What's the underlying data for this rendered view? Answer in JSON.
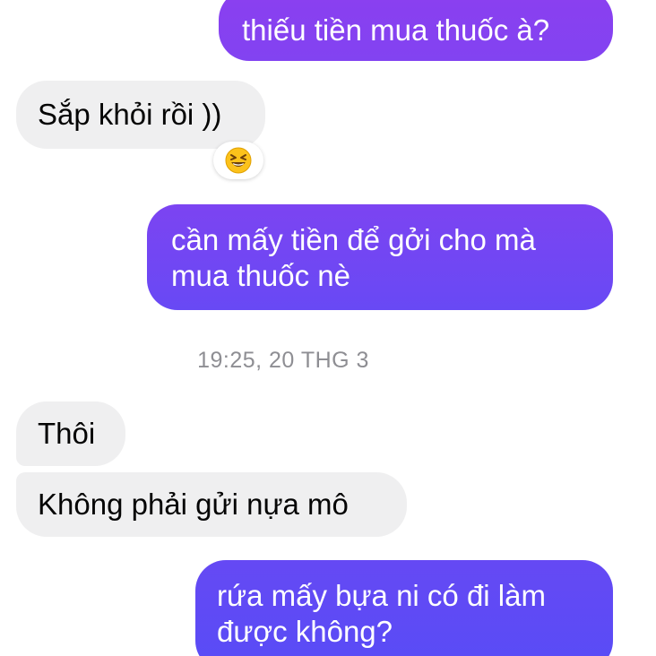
{
  "colors": {
    "sent_top": "#8a3ff0",
    "sent_bottom": "#5b4bf5",
    "received_bg": "#efeff0",
    "timestamp": "#8e8e93"
  },
  "messages": [
    {
      "direction": "sent",
      "text": "thiếu tiền mua thuốc à?"
    },
    {
      "direction": "received",
      "text": "Sắp khỏi rồi ))",
      "reaction": "grinning-squinting-face"
    },
    {
      "direction": "sent",
      "lines": [
        "cần mấy tiền để gởi cho mà",
        "mua thuốc nè"
      ]
    },
    {
      "direction": "received",
      "text": "Thôi"
    },
    {
      "direction": "received",
      "text": "Không phải gửi nựa mô"
    },
    {
      "direction": "sent",
      "lines": [
        "rứa mấy bựa ni có đi làm",
        "được không?"
      ]
    }
  ],
  "timestamp": "19:25, 20 THG 3"
}
